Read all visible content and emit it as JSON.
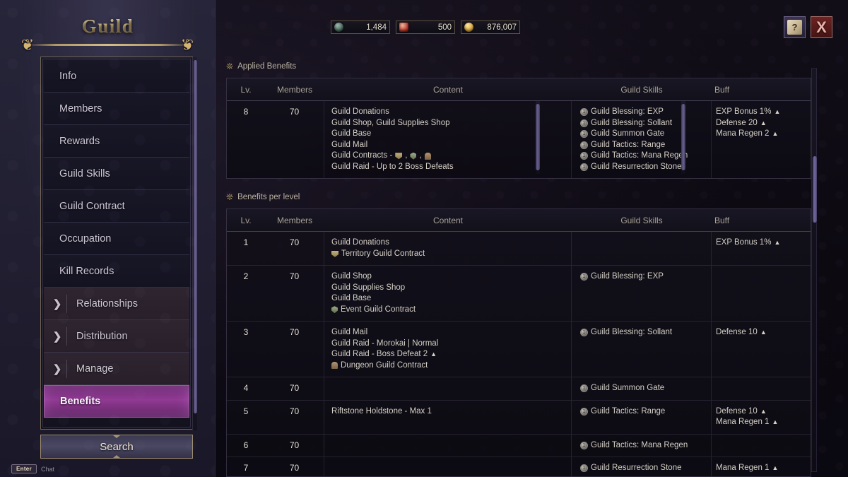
{
  "window": {
    "title": "Guild"
  },
  "topbar": {
    "currencies": [
      {
        "icon": "silver-coin-icon",
        "value": "1,484"
      },
      {
        "icon": "guild-token-icon",
        "value": "500"
      },
      {
        "icon": "gold-coin-icon",
        "value": "876,007"
      }
    ],
    "help_button": {
      "icon": "help-scroll-icon",
      "label": "?"
    },
    "close_button": {
      "icon": "close-x-icon",
      "label": "X"
    }
  },
  "sidebar": {
    "items": [
      {
        "label": "Info",
        "expandable": false,
        "active": false
      },
      {
        "label": "Members",
        "expandable": false,
        "active": false
      },
      {
        "label": "Rewards",
        "expandable": false,
        "active": false
      },
      {
        "label": "Guild Skills",
        "expandable": false,
        "active": false
      },
      {
        "label": "Guild Contract",
        "expandable": false,
        "active": false
      },
      {
        "label": "Occupation",
        "expandable": false,
        "active": false
      },
      {
        "label": "Kill Records",
        "expandable": false,
        "active": false
      },
      {
        "label": "Relationships",
        "expandable": true,
        "active": false
      },
      {
        "label": "Distribution",
        "expandable": true,
        "active": false
      },
      {
        "label": "Manage",
        "expandable": true,
        "active": false
      },
      {
        "label": "Benefits",
        "expandable": false,
        "active": true
      }
    ],
    "search_label": "Search"
  },
  "footer": {
    "chat_key": "Enter",
    "chat_label": "Chat"
  },
  "columns": {
    "lv": "Lv.",
    "members": "Members",
    "content": "Content",
    "skills": "Guild Skills",
    "buff": "Buff"
  },
  "applied": {
    "title": "Applied Benefits",
    "rows": [
      {
        "lv": "8",
        "members": "70",
        "content": [
          {
            "text": "Guild Donations"
          },
          {
            "text": "Guild Shop, Guild Supplies Shop"
          },
          {
            "text": "Guild Base"
          },
          {
            "text": "Guild Mail"
          },
          {
            "text": "Guild Contracts - ",
            "icons": [
              "banner",
              "shield",
              "dungeon"
            ]
          },
          {
            "text": "Guild Raid - Up to 2 Boss Defeats"
          }
        ],
        "skills": [
          "Guild Blessing: EXP",
          "Guild Blessing: Sollant",
          "Guild Summon Gate",
          "Guild Tactics: Range",
          "Guild Tactics: Mana Regen",
          "Guild Resurrection Stone"
        ],
        "buffs": [
          {
            "text": "EXP Bonus 1%",
            "arrow": true
          },
          {
            "text": "Defense 20",
            "arrow": true
          },
          {
            "text": "Mana Regen 2",
            "arrow": true
          }
        ]
      }
    ]
  },
  "per_level": {
    "title": "Benefits per level",
    "rows": [
      {
        "lv": "1",
        "members": "70",
        "content": [
          {
            "text": "Guild Donations"
          },
          {
            "text": "Territory Guild Contract",
            "icon": "banner"
          }
        ],
        "skills": [],
        "buffs": [
          {
            "text": "EXP Bonus 1%",
            "arrow": true
          }
        ]
      },
      {
        "lv": "2",
        "members": "70",
        "content": [
          {
            "text": "Guild Shop"
          },
          {
            "text": "Guild Supplies Shop"
          },
          {
            "text": "Guild Base"
          },
          {
            "text": "Event Guild Contract",
            "icon": "shield"
          }
        ],
        "skills": [
          "Guild Blessing: EXP"
        ],
        "buffs": []
      },
      {
        "lv": "3",
        "members": "70",
        "content": [
          {
            "text": "Guild Mail"
          },
          {
            "text": "Guild Raid - Morokai | Normal"
          },
          {
            "text": "Guild Raid - Boss Defeat 2",
            "arrow": true
          },
          {
            "text": "Dungeon Guild Contract",
            "icon": "dungeon"
          }
        ],
        "skills": [
          "Guild Blessing: Sollant"
        ],
        "buffs": [
          {
            "text": "Defense 10",
            "arrow": true
          }
        ]
      },
      {
        "lv": "4",
        "members": "70",
        "content": [],
        "skills": [
          "Guild Summon Gate"
        ],
        "buffs": []
      },
      {
        "lv": "5",
        "members": "70",
        "content": [
          {
            "text": "Riftstone Holdstone - Max 1"
          }
        ],
        "skills": [
          "Guild Tactics: Range"
        ],
        "buffs": [
          {
            "text": "Defense 10",
            "arrow": true
          },
          {
            "text": "Mana Regen 1",
            "arrow": true
          }
        ]
      },
      {
        "lv": "6",
        "members": "70",
        "content": [],
        "skills": [
          "Guild Tactics: Mana Regen"
        ],
        "buffs": []
      },
      {
        "lv": "7",
        "members": "70",
        "content": [],
        "skills": [
          "Guild Resurrection Stone"
        ],
        "buffs": [
          {
            "text": "Mana Regen 1",
            "arrow": true
          }
        ]
      }
    ]
  },
  "colors": {
    "accent_gold": "#d4b472",
    "active_purple": "#913a94",
    "close_red": "#6d2322",
    "panel_navy": "#232134"
  }
}
